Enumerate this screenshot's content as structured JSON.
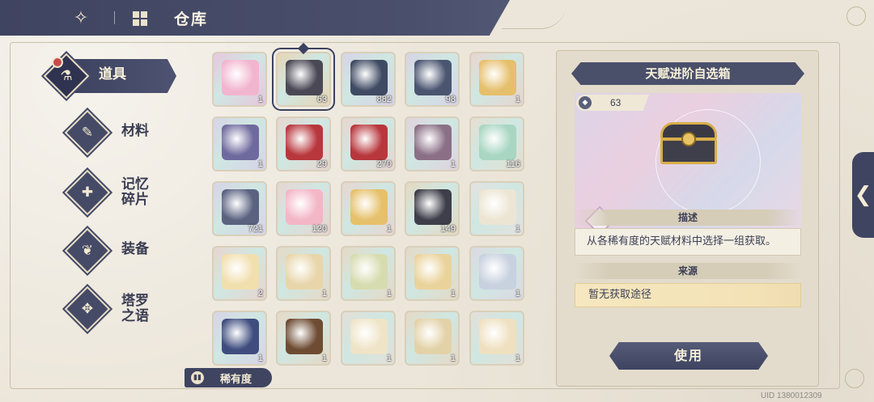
{
  "header": {
    "title": "仓库",
    "back_icon": "back-arrow-icon",
    "home_icon": "grid-home-icon"
  },
  "nav": {
    "items": [
      {
        "label": "道具",
        "icon": "potion-icon",
        "active": true
      },
      {
        "label": "材料",
        "icon": "scroll-icon",
        "active": false
      },
      {
        "label": "记忆\n碎片",
        "icon": "puzzle-icon",
        "active": false
      },
      {
        "label": "装备",
        "icon": "armor-icon",
        "active": false
      },
      {
        "label": "塔罗\n之语",
        "icon": "tarot-icon",
        "active": false
      }
    ]
  },
  "grid": {
    "items": [
      {
        "name": "pink-flower-item",
        "qty": "1",
        "bg": "#e7c7dd",
        "art": "#f2b5cf"
      },
      {
        "name": "talent-selector-chest",
        "qty": "63",
        "bg": "#e8d5b6",
        "art": "#4a4855",
        "selected": true
      },
      {
        "name": "dark-crystal-chest",
        "qty": "882",
        "bg": "#d7d4e6",
        "art": "#3f4a63"
      },
      {
        "name": "dark-crystal-chest-2",
        "qty": "98",
        "bg": "#d7d4e6",
        "art": "#4a5570"
      },
      {
        "name": "golden-orb",
        "qty": "1",
        "bg": "#e8d5d0",
        "art": "#e6bf6c"
      },
      {
        "name": "portrait-card",
        "qty": "1",
        "bg": "#d7d4e6",
        "art": "#6f6a9e"
      },
      {
        "name": "red-chest",
        "qty": "29",
        "bg": "#e8d5d0",
        "art": "#b8373d"
      },
      {
        "name": "red-chest-2",
        "qty": "270",
        "bg": "#e8d5d0",
        "art": "#b8373d"
      },
      {
        "name": "portrait-card-2",
        "qty": "1",
        "bg": "#e0d3de",
        "art": "#8a6f86"
      },
      {
        "name": "rainbow-crystals",
        "qty": "116",
        "bg": "#e6dfd0",
        "art": "#a8d6c2"
      },
      {
        "name": "silver-crystal-box",
        "qty": "721",
        "bg": "#d7d4e6",
        "art": "#5a6280"
      },
      {
        "name": "cotton-candy",
        "qty": "120",
        "bg": "#e8d5d0",
        "art": "#f3b6c7"
      },
      {
        "name": "golden-orb-2",
        "qty": "1",
        "bg": "#e8d5d0",
        "art": "#e6c06a"
      },
      {
        "name": "dark-gold-chest",
        "qty": "149",
        "bg": "#e4d9c2",
        "art": "#3e3e4a"
      },
      {
        "name": "star-emblem",
        "qty": "1",
        "bg": "#e3e2e0",
        "art": "#ece5d3"
      },
      {
        "name": "crystal-wings",
        "qty": "2",
        "bg": "#e8d5d0",
        "art": "#f1dfae"
      },
      {
        "name": "red-seal-letter",
        "qty": "1",
        "bg": "#e6d9c6",
        "art": "#e8d6aa"
      },
      {
        "name": "green-seal-letter",
        "qty": "1",
        "bg": "#e6d9c6",
        "art": "#d7dcb0"
      },
      {
        "name": "winged-letter",
        "qty": "1",
        "bg": "#e6d9c6",
        "art": "#ead39b"
      },
      {
        "name": "blue-seal-letter",
        "qty": "1",
        "bg": "#dcd9e2",
        "art": "#c8d1df"
      },
      {
        "name": "blue-book",
        "qty": "1",
        "bg": "#d7d4e6",
        "art": "#3e4d7e"
      },
      {
        "name": "brown-book",
        "qty": "1",
        "bg": "#e6d9c6",
        "art": "#6e4c33"
      },
      {
        "name": "feather-ornament",
        "qty": "1",
        "bg": "#e3dfd8",
        "art": "#efe4c7"
      },
      {
        "name": "feather-ornament-2",
        "qty": "1",
        "bg": "#e6d9c6",
        "art": "#e3d2a8"
      },
      {
        "name": "feather-ornament-3",
        "qty": "1",
        "bg": "#e3dfd8",
        "art": "#efe0c0"
      }
    ]
  },
  "filter": {
    "label": "稀有度",
    "icon": "sort-icon"
  },
  "detail": {
    "title": "天赋进阶自选箱",
    "count": "63",
    "desc_header": "描述",
    "desc": "从各稀有度的天赋材料中选择一组获取。",
    "source_header": "来源",
    "source": "暂无获取途径",
    "use_label": "使用"
  },
  "side_handle": "❮",
  "uid": "UID 1380012309"
}
